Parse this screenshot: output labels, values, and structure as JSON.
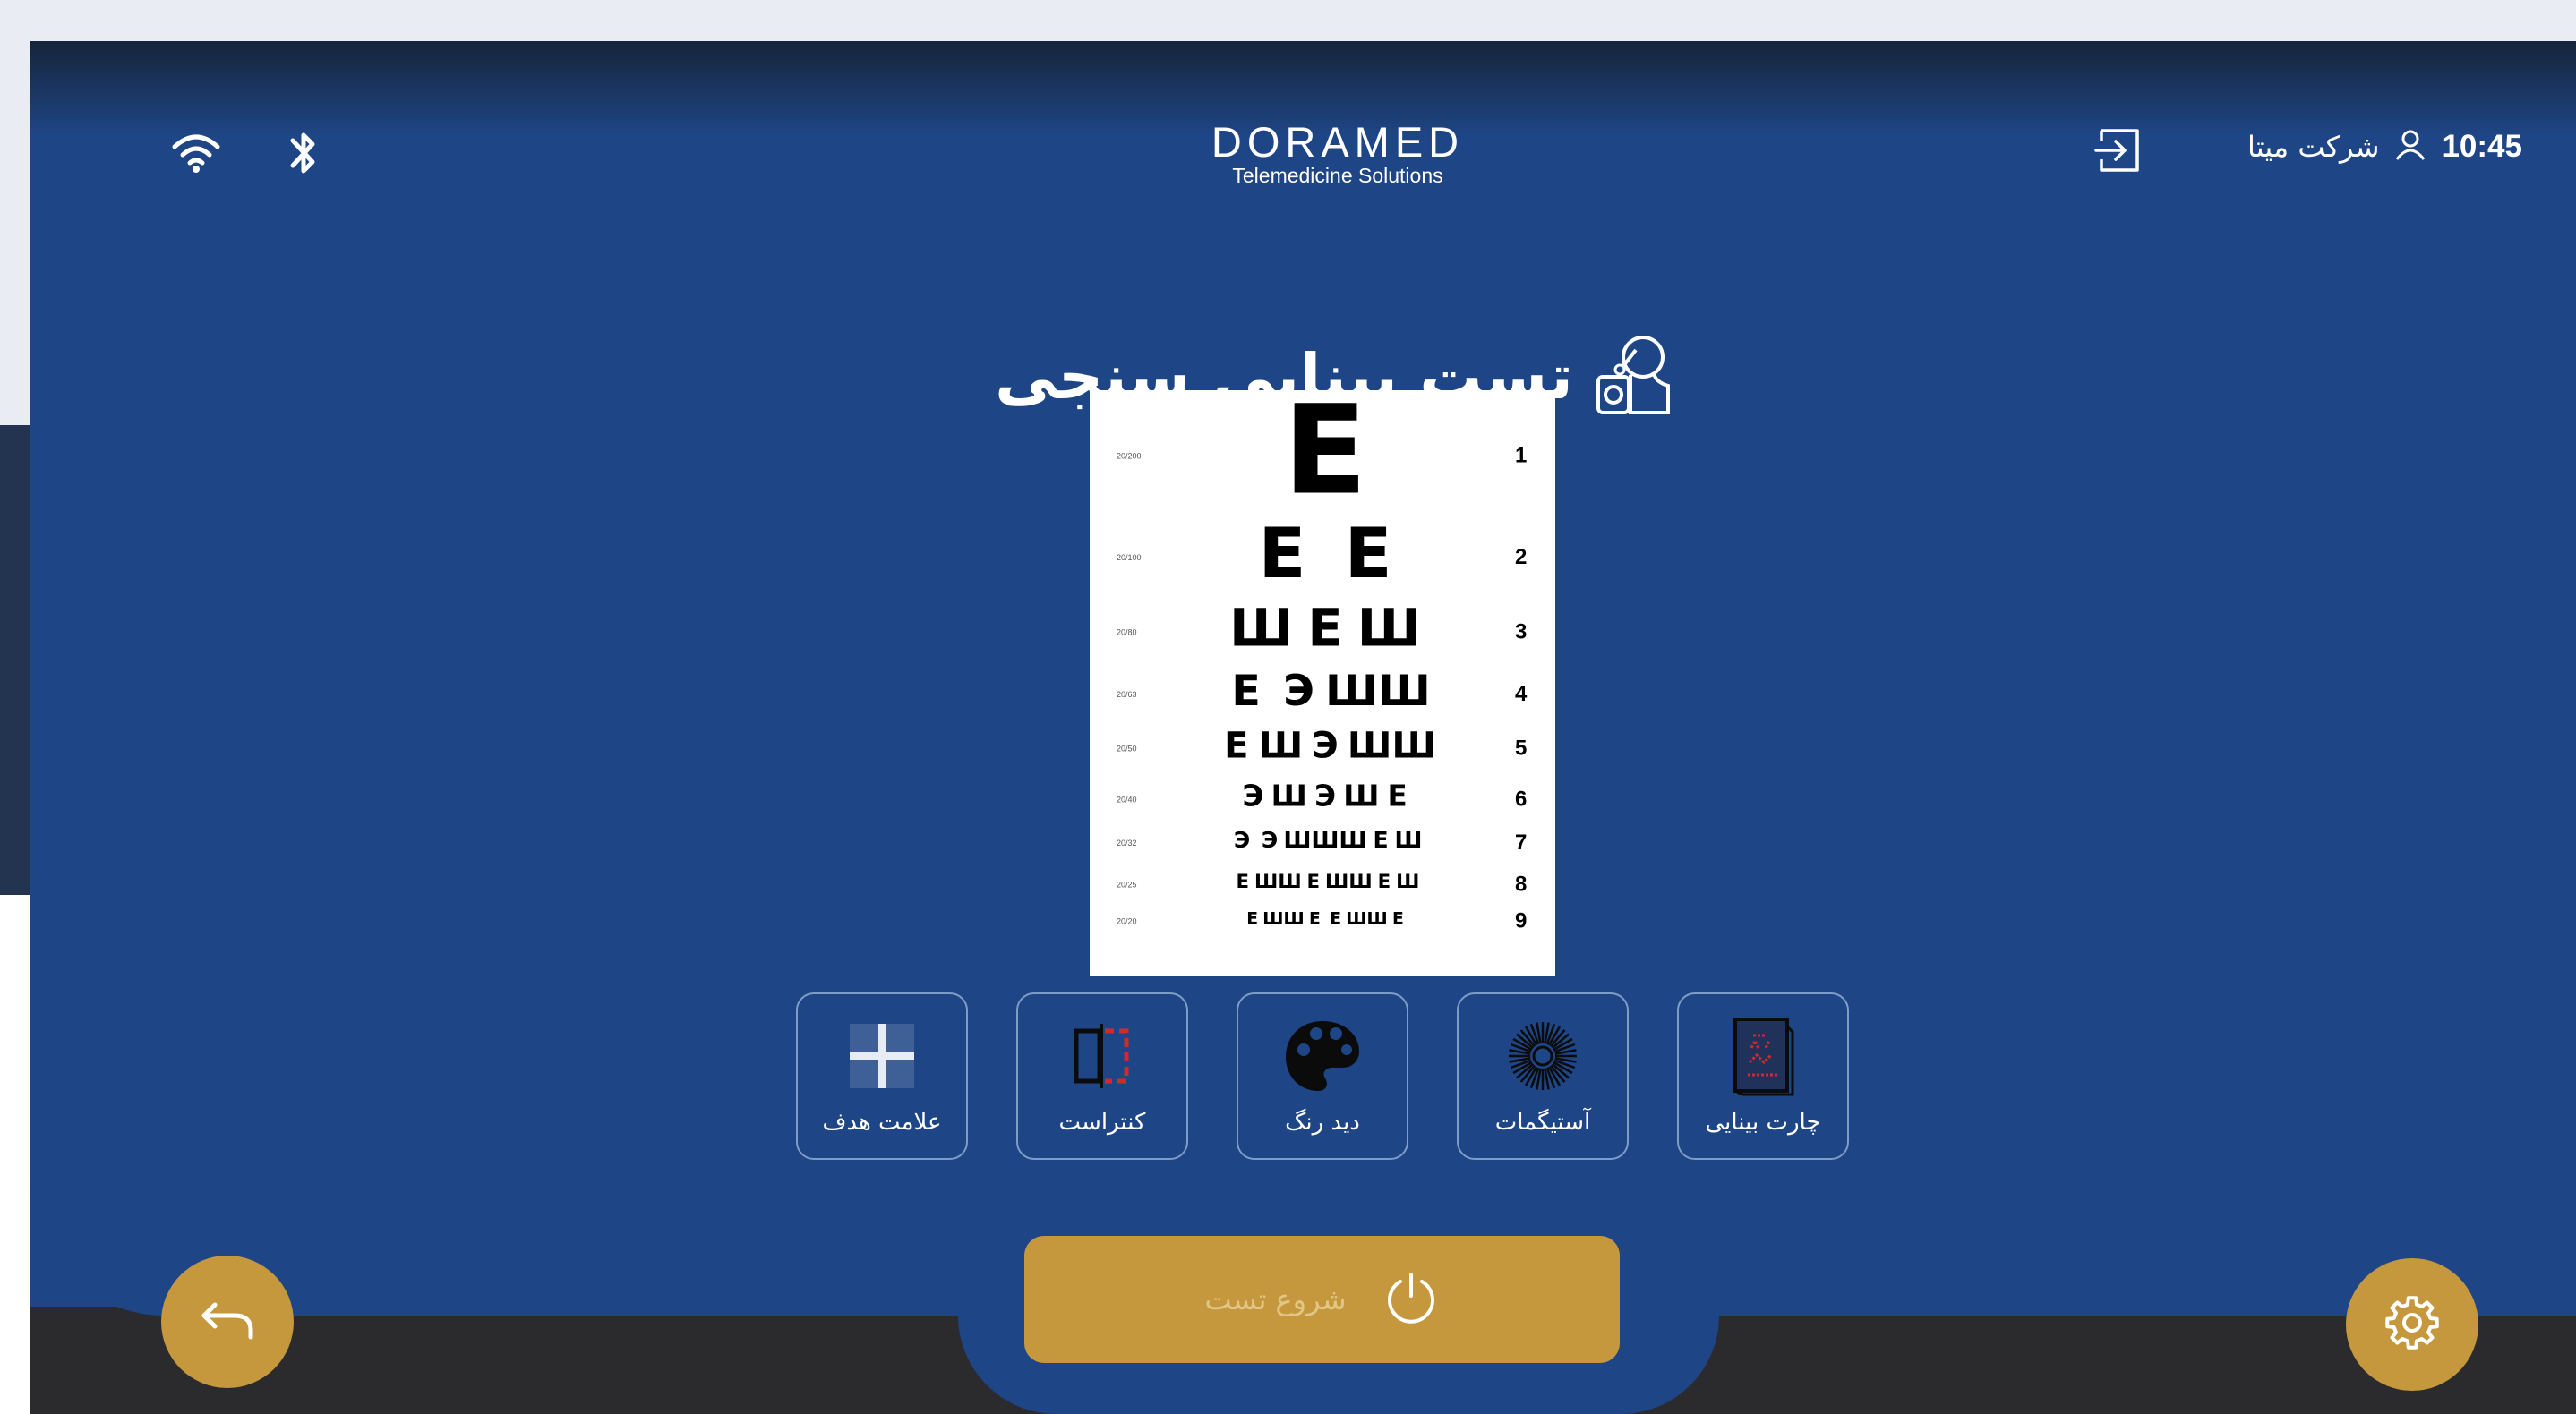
{
  "header": {
    "logo_title": "DORAMED",
    "logo_subtitle": "Telemedicine Solutions",
    "company": "شرکت میتا",
    "time": "10:45",
    "icons": [
      "wifi-icon",
      "bluetooth-icon",
      "logout-icon",
      "user-icon"
    ]
  },
  "page": {
    "title": "تست بینایی سنجی",
    "title_icon": "eye-exam-icon"
  },
  "eye_chart": {
    "rows": [
      {
        "number": "1",
        "letters": "E",
        "acuity": "20/200"
      },
      {
        "number": "2",
        "letters": "ЕЕ",
        "acuity": "20/100"
      },
      {
        "number": "3",
        "letters": "ШЕШ",
        "acuity": "20/80"
      },
      {
        "number": "4",
        "letters": "ЕЭШШ",
        "acuity": "20/63"
      },
      {
        "number": "5",
        "letters": "ЕШЭШШ",
        "acuity": "20/50"
      },
      {
        "number": "6",
        "letters": "ЭШЭШЕ",
        "acuity": "20/40"
      },
      {
        "number": "7",
        "letters": "ЭЭШШШЕШ",
        "acuity": "20/32"
      },
      {
        "number": "8",
        "letters": "ЕШШЕШШЕШ",
        "acuity": "20/25"
      },
      {
        "number": "9",
        "letters": "ЕШШЕЕШШЕ",
        "acuity": "20/20"
      }
    ]
  },
  "tools": [
    {
      "label": "علامت هدف",
      "icon": "target-cross-icon"
    },
    {
      "label": "کنتراست",
      "icon": "contrast-icon"
    },
    {
      "label": "دید رنگ",
      "icon": "palette-icon"
    },
    {
      "label": "آستیگمات",
      "icon": "astigmatism-icon"
    },
    {
      "label": "چارت بینایی",
      "icon": "vision-chart-icon"
    }
  ],
  "actions": {
    "start_label": "شروع تست",
    "start_icon": "power-icon",
    "back_icon": "back-arrow-icon",
    "settings_icon": "gear-icon"
  },
  "colors": {
    "panel": "#1e4585",
    "accent": "#c5983d",
    "bottom_bar": "#2b2b2d"
  }
}
